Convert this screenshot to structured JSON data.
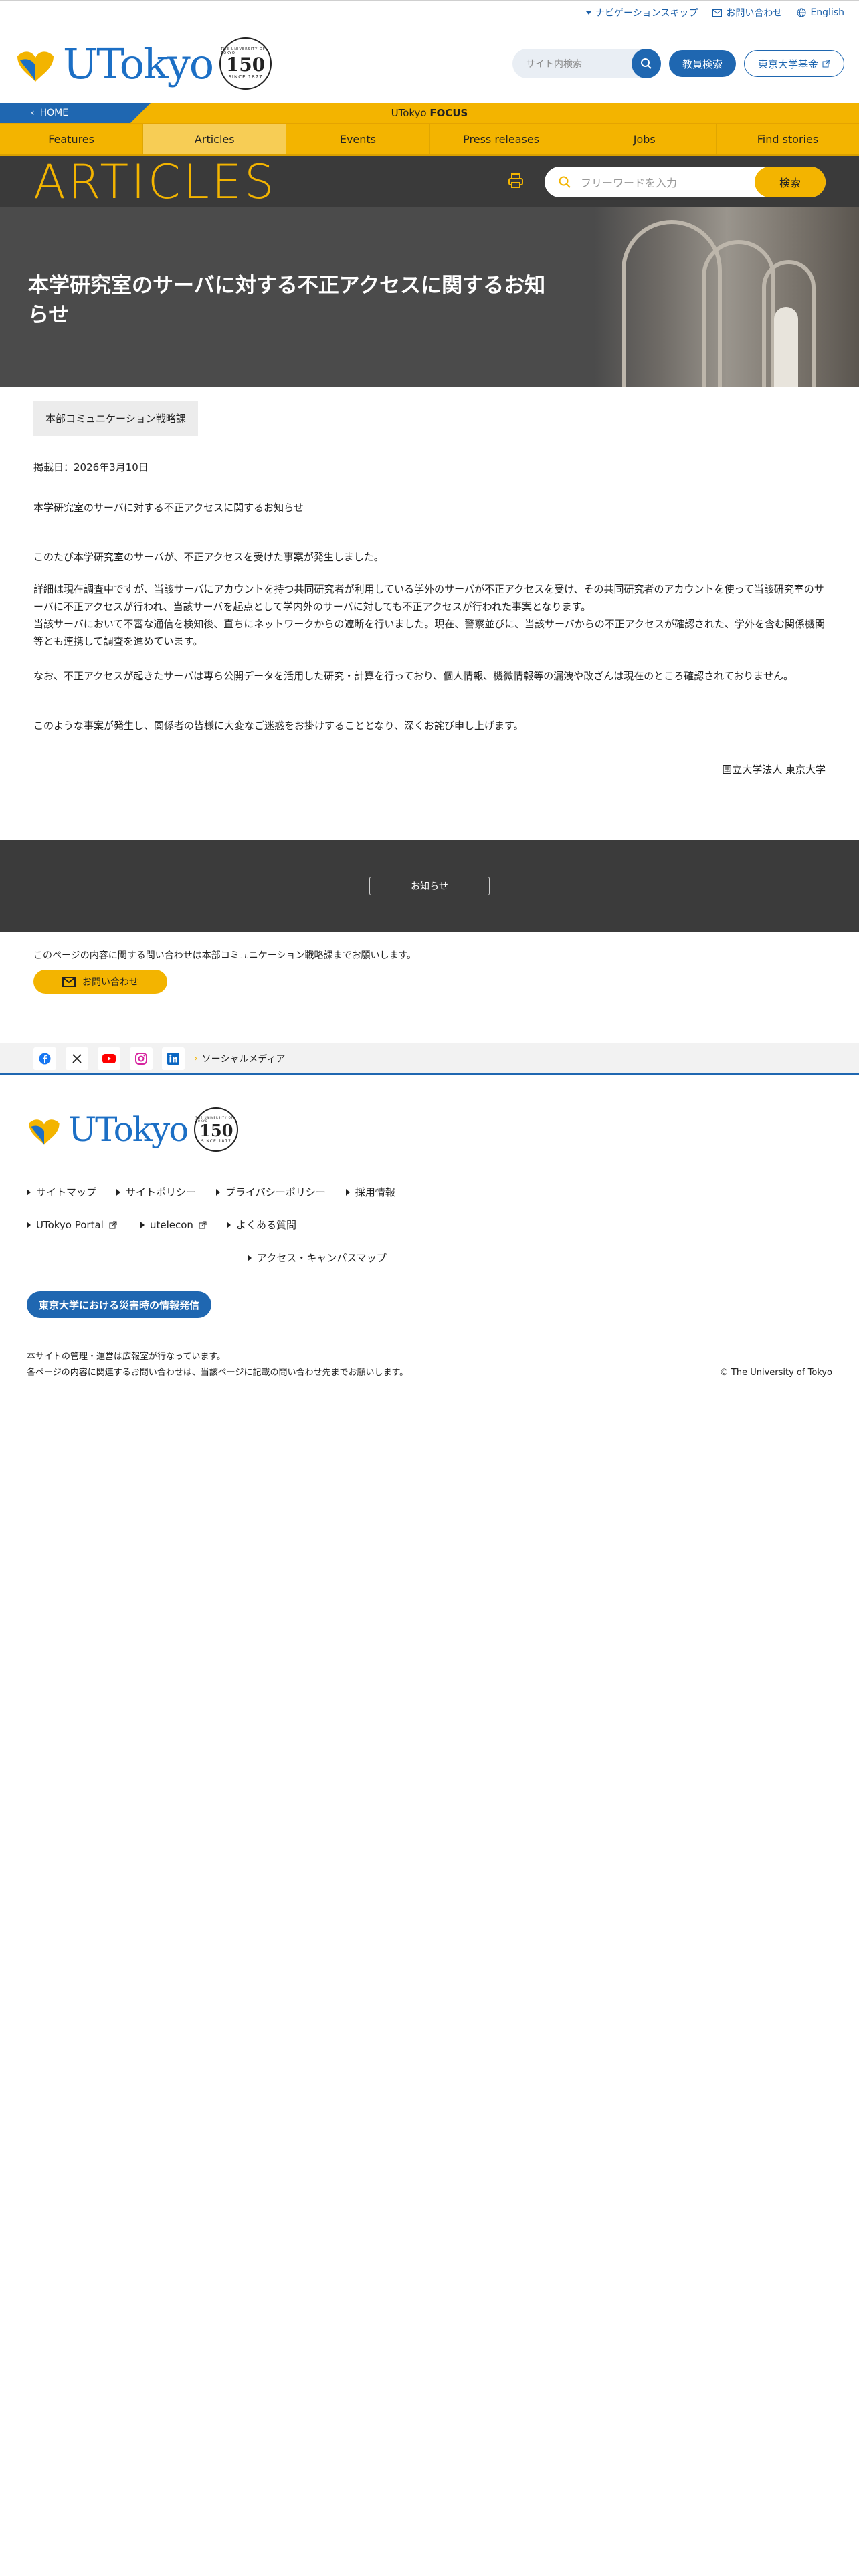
{
  "topbar": {
    "skip_nav": "ナビゲーションスキップ",
    "contact": "お問い合わせ",
    "english": "English"
  },
  "header": {
    "logo_text": "UTokyo",
    "seal_number": "150",
    "seal_top": "THE UNIVERSITY OF TOKYO",
    "seal_bottom": "SINCE 1877",
    "search_placeholder": "サイト内検索",
    "staff_search": "教員検索",
    "fund": "東京大学基金"
  },
  "focusbar": {
    "home": "HOME",
    "brand_prefix": "UTokyo ",
    "brand_bold": "FOCUS"
  },
  "nav": {
    "items": [
      {
        "label": "Features"
      },
      {
        "label": "Articles"
      },
      {
        "label": "Events"
      },
      {
        "label": "Press releases"
      },
      {
        "label": "Jobs"
      },
      {
        "label": "Find stories"
      }
    ]
  },
  "articles": {
    "heading": "ARTICLES",
    "free_word_placeholder": "フリーワードを入力",
    "search_button": "検索"
  },
  "article": {
    "title": "本学研究室のサーバに対する不正アクセスに関するお知らせ",
    "department": "本部コミュニケーション戦略課",
    "date": "掲載日：2026年3月10日",
    "subject": "本学研究室のサーバに対する不正アクセスに関するお知らせ",
    "para1": "このたび本学研究室のサーバが、不正アクセスを受けた事案が発生しました。",
    "para2": "詳細は現在調査中ですが、当該サーバにアカウントを持つ共同研究者が利用している学外のサーバが不正アクセスを受け、その共同研究者のアカウントを使って当該研究室のサーバに不正アクセスが行われ、当該サーバを起点として学内外のサーバに対しても不正アクセスが行われた事案となります。",
    "para3": "当該サーバにおいて不審な通信を検知後、直ちにネットワークからの遮断を行いました。現在、警察並びに、当該サーバからの不正アクセスが確認された、学外を含む関係機関等とも連携して調査を進めています。",
    "para4": "なお、不正アクセスが起きたサーバは専ら公開データを活用した研究・計算を行っており、個人情報、機微情報等の漏洩や改ざんは現在のところ確認されておりません。",
    "para5": "このような事案が発生し、関係者の皆様に大変なご迷惑をお掛けすることとなり、深くお詫び申し上げます。",
    "signature": "国立大学法人 東京大学"
  },
  "notice": {
    "button": "お知らせ"
  },
  "inquiry": {
    "text": "このページの内容に関する問い合わせは本部コミュニケーション戦略課までお願いします。",
    "button": "お問い合わせ"
  },
  "social": {
    "label": "ソーシャルメディア",
    "icons": [
      "facebook-icon",
      "x-icon",
      "youtube-icon",
      "instagram-icon",
      "linkedin-icon"
    ]
  },
  "footer": {
    "links": [
      {
        "label": "サイトマップ"
      },
      {
        "label": "サイトポリシー"
      },
      {
        "label": "プライバシーポリシー"
      },
      {
        "label": "採用情報"
      },
      {
        "label": "UTokyo Portal"
      },
      {
        "label": "utelecon"
      },
      {
        "label": "よくある質問"
      },
      {
        "label": "アクセス・キャンパスマップ"
      }
    ],
    "disaster_button": "東京大学における災害時の情報発信",
    "managed_by": "本サイトの管理・運営は広報室が行なっています。",
    "inquiry_note": "各ページの内容に関連するお問い合わせは、当該ページに記載の問い合わせ先までお願いします。",
    "copyright": "© The University of Tokyo"
  },
  "colors": {
    "brand_blue": "#1f67b1",
    "accent_yellow": "#f3b400",
    "dark_band": "#3a3a3a"
  }
}
